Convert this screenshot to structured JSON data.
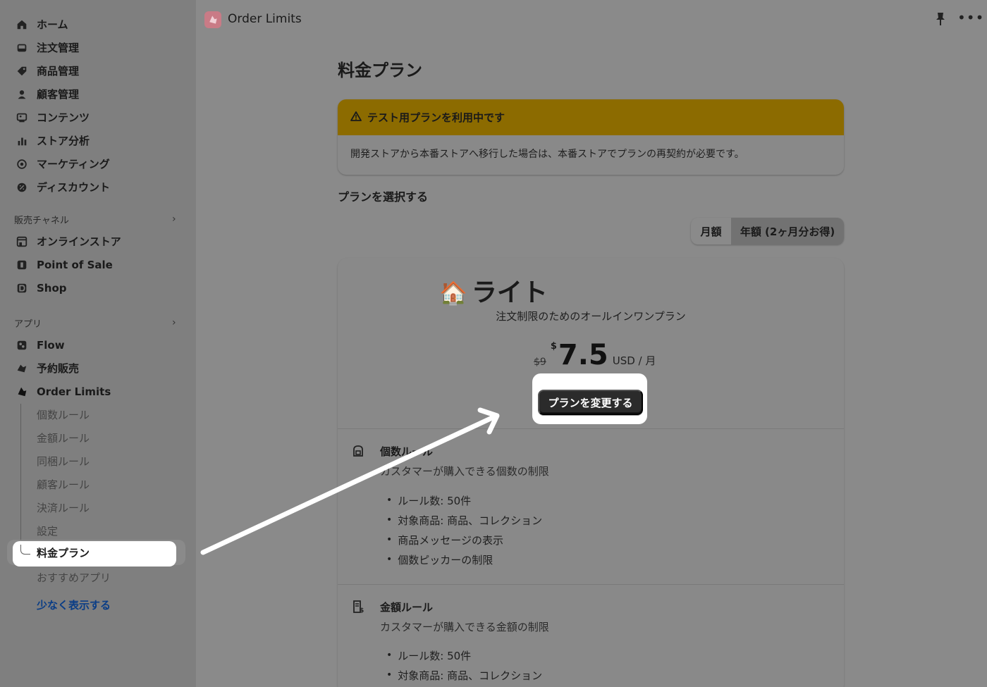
{
  "sidebar": {
    "main_items": [
      {
        "label": "ホーム",
        "icon": "home-icon"
      },
      {
        "label": "注文管理",
        "icon": "inbox-icon"
      },
      {
        "label": "商品管理",
        "icon": "tag-icon"
      },
      {
        "label": "顧客管理",
        "icon": "person-icon"
      },
      {
        "label": "コンテンツ",
        "icon": "content-icon"
      },
      {
        "label": "ストア分析",
        "icon": "bar-chart-icon"
      },
      {
        "label": "マーケティング",
        "icon": "target-icon"
      },
      {
        "label": "ディスカウント",
        "icon": "discount-icon"
      }
    ],
    "sales_channels": {
      "heading": "販売チャネル",
      "items": [
        {
          "label": "オンラインストア",
          "icon": "storefront-icon"
        },
        {
          "label": "Point of Sale",
          "icon": "pos-icon"
        },
        {
          "label": "Shop",
          "icon": "shop-icon"
        }
      ]
    },
    "apps": {
      "heading": "アプリ",
      "items": [
        {
          "label": "Flow",
          "icon": "flow-icon"
        },
        {
          "label": "予約販売",
          "icon": "preorder-icon"
        },
        {
          "label": "Order Limits",
          "icon": "order-limits-icon"
        }
      ],
      "sub_items": [
        "個数ルール",
        "金額ルール",
        "同梱ルール",
        "顧客ルール",
        "決済ルール",
        "設定",
        "料金プラン",
        "おすすめアプリ"
      ]
    },
    "show_less": "少なく表示する"
  },
  "topbar": {
    "app_title": "Order Limits"
  },
  "page": {
    "title": "料金プラン",
    "banner": {
      "title": "テスト用プランを利用中です",
      "body": "開発ストアから本番ストアへ移行した場合は、本番ストアでプランの再契約が必要です。"
    },
    "plan_select_label": "プランを選択する",
    "billing_toggle": {
      "monthly": "月額",
      "yearly": "年額 (2ヶ月分お得)",
      "selected": "yearly"
    },
    "plan": {
      "name": "ライト",
      "emoji": "🏠",
      "description": "注文制限のためのオールインワンプラン",
      "old_price": "$9",
      "currency_symbol": "$",
      "price": "7.5",
      "price_unit": "USD / 月",
      "cta": "プランを変更する"
    },
    "features": [
      {
        "title": "個数ルール",
        "description": "カスタマーが購入できる個数の制限",
        "bullets": [
          "ルール数: 50件",
          "対象商品: 商品、コレクション",
          "商品メッセージの表示",
          "個数ピッカーの制限"
        ]
      },
      {
        "title": "金額ルール",
        "description": "カスタマーが購入できる金額の制限",
        "bullets": [
          "ルール数: 50件",
          "対象商品: 商品、コレクション"
        ]
      }
    ]
  },
  "colors": {
    "overlay_bg": "#8a8a8a",
    "banner_warning": "#8c6b00",
    "primary_button": "#2b2b2b",
    "highlight": "#ffffff",
    "link": "#0a3d86"
  }
}
